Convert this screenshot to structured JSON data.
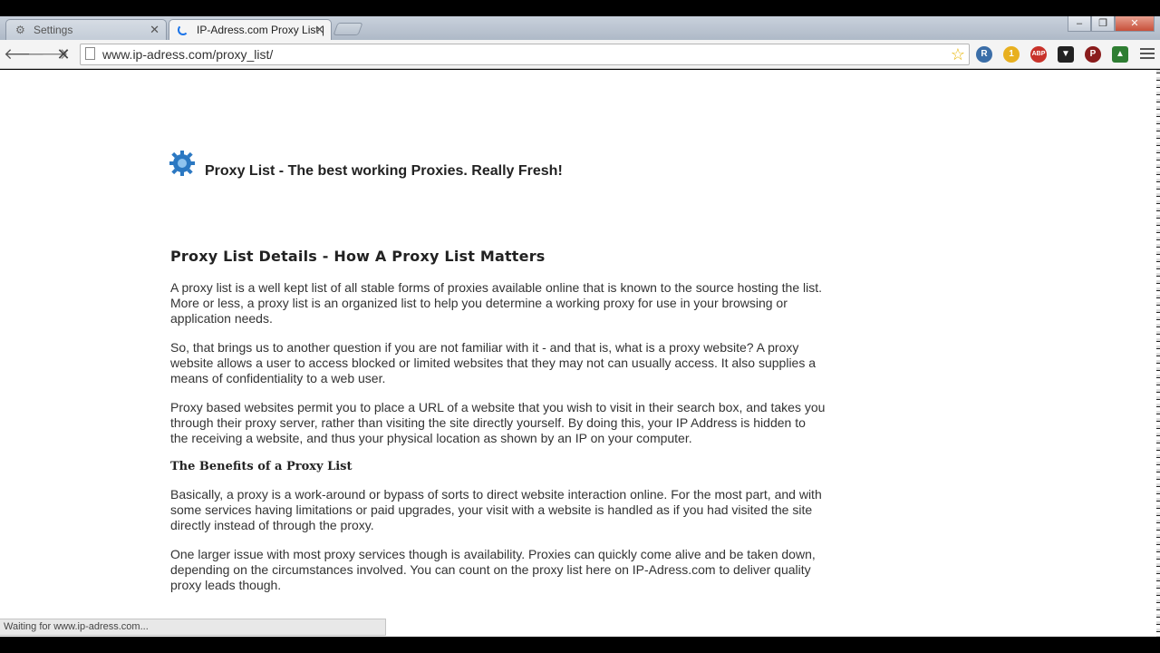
{
  "browser": {
    "tabs": [
      {
        "label": "Settings",
        "active": false
      },
      {
        "label": "IP-Adress.com Proxy List |",
        "active": true
      }
    ],
    "url": "www.ip-adress.com/proxy_list/",
    "status_text": "Waiting for www.ip-adress.com..."
  },
  "site": {
    "title": "Proxy List - The best working Proxies. Really Fresh!"
  },
  "article": {
    "heading": "Proxy List Details - How A Proxy List Matters",
    "paragraphs_1": [
      "A proxy list is a well kept list of all stable forms of proxies available online that is known to the source hosting the list. More or less, a proxy list is an organized list to help you determine a working proxy for use in your browsing or application needs.",
      "So, that brings us to another question if you are not familiar with it - and that is, what is a proxy website? A proxy website allows a user to access blocked or limited websites that they may not can usually access. It also supplies a means of confidentiality to a web user.",
      "Proxy based websites permit you to place a URL of a website that you wish to visit in their search box, and takes you through their proxy server, rather than visiting the site directly yourself. By doing this, your IP Address is hidden to the receiving a website, and thus your physical location as shown by an IP on your computer."
    ],
    "subheading": "The Benefits of a Proxy List",
    "paragraphs_2": [
      "Basically, a proxy is a work-around or bypass of sorts to direct website interaction online. For the most part, and with some services having limitations or paid upgrades, your visit with a website is handled as if you had visited the site directly instead of through the proxy.",
      "One larger issue with most proxy services though is availability. Proxies can quickly come alive and be taken down, depending on the circumstances involved. You can count on the proxy list here on IP-Adress.com to deliver quality proxy leads though."
    ]
  },
  "extensions": [
    {
      "icon": "r-extension-icon",
      "color": "#3b6ea8",
      "glyph": "R"
    },
    {
      "icon": "coin-extension-icon",
      "color": "#e8b020",
      "glyph": "1"
    },
    {
      "icon": "adblock-icon",
      "color": "#c8322a",
      "glyph": "ABP"
    },
    {
      "icon": "owl-extension-icon",
      "color": "#222222",
      "glyph": "▼"
    },
    {
      "icon": "p-extension-icon",
      "color": "#8a1c1c",
      "glyph": "P"
    },
    {
      "icon": "green-extension-icon",
      "color": "#2e7d32",
      "glyph": "▲"
    }
  ]
}
